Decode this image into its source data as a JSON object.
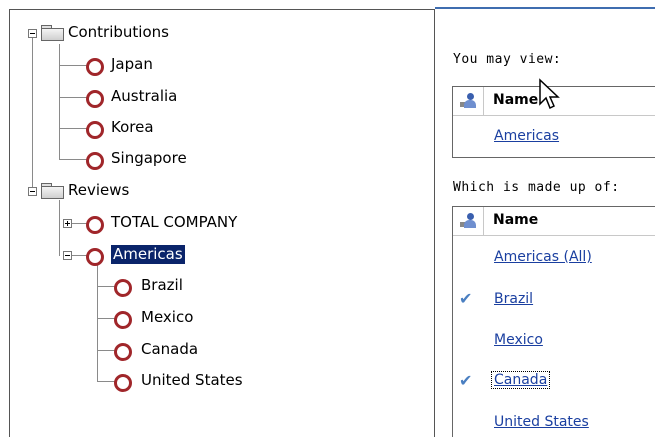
{
  "tree": {
    "folders": [
      {
        "label": "Contributions",
        "children": [
          "Japan",
          "Australia",
          "Korea",
          "Singapore"
        ]
      },
      {
        "label": "Reviews",
        "children": [
          "TOTAL COMPANY",
          "Americas"
        ]
      }
    ],
    "americas_children": [
      "Brazil",
      "Mexico",
      "Canada",
      "United States"
    ],
    "selected": "Americas"
  },
  "right": {
    "view_label": "You may view:",
    "view_header": "Name",
    "view_item": "Americas",
    "made_label": "Which is made up of:",
    "made_header": "Name",
    "made_items": [
      {
        "label": "Americas (All)",
        "checked": false
      },
      {
        "label": "Brazil",
        "checked": true
      },
      {
        "label": "Mexico",
        "checked": false
      },
      {
        "label": "Canada",
        "checked": true
      },
      {
        "label": "United States",
        "checked": false
      }
    ]
  },
  "colors": {
    "selection": "#0a246a",
    "link": "#1a3fa0",
    "ring": "#a0262a",
    "check": "#4a7fc1"
  },
  "icons": {
    "folder": "folder-icon",
    "ring": "ring-icon",
    "user": "user-group-icon",
    "check": "checkmark-icon",
    "cursor": "mouse-cursor-icon"
  }
}
